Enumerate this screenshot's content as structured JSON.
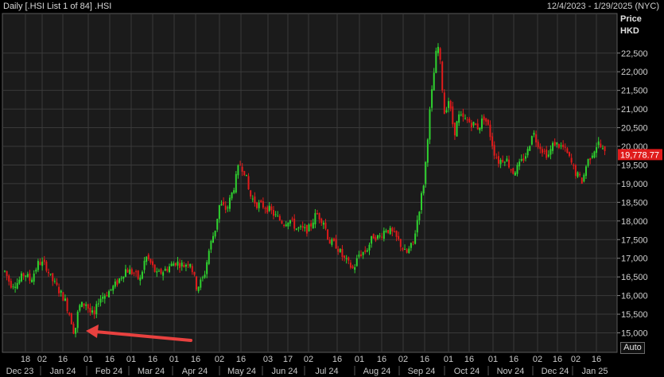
{
  "title": {
    "left": "Daily [.HSI List 1 of 84] .HSI",
    "right": "12/4/2023 - 1/29/2025 (NYC)"
  },
  "axis": {
    "price_label": "Price",
    "currency_label": "HKD",
    "last_price_label": "19,778.77",
    "auto_button": "Auto"
  },
  "colors": {
    "background": "#000000",
    "plot_background": "#1b1b1b",
    "grid": "#3a3a3a",
    "up": "#2fd22f",
    "down": "#e01b1b",
    "arrow": "#e8413f",
    "last_price_bg": "#e01b1b"
  },
  "icons": {
    "annotation": "red-arrow-icon"
  },
  "chart_data": {
    "type": "candlestick",
    "interval": "Daily",
    "symbol": ".HSI",
    "date_range": "12/4/2023 - 1/29/2025 (NYC)",
    "ylabel": "Price HKD",
    "ylim": [
      14600,
      23100
    ],
    "yticks": [
      15000,
      15500,
      16000,
      16500,
      17000,
      17500,
      18000,
      18500,
      19000,
      19500,
      20000,
      20500,
      21000,
      21500,
      22000,
      22500
    ],
    "ytick_labels": [
      "15,000",
      "15,500",
      "16,000",
      "16,500",
      "17,000",
      "17,500",
      "18,000",
      "18,500",
      "19,000",
      "19,500",
      "20,000",
      "20,500",
      "21,000",
      "21,500",
      "22,000",
      "22,500"
    ],
    "last_price": 19778.77,
    "x_day_ticks": [
      "18",
      "02",
      "16",
      "01",
      "16",
      "01",
      "16",
      "01",
      "16",
      "02",
      "16",
      "03",
      "17",
      "02",
      "16",
      "01",
      "16",
      "02",
      "16",
      "01",
      "16",
      "01",
      "16",
      "02",
      "16",
      "02",
      "16"
    ],
    "x_month_ticks": [
      "Dec 23",
      "Jan 24",
      "Feb 24",
      "Mar 24",
      "Apr 24",
      "May 24",
      "Jun 24",
      "Jul 24",
      "Aug 24",
      "Sep 24",
      "Oct 24",
      "Nov 24",
      "Dec 24",
      "Jan 25"
    ],
    "close_path": [
      [
        "2023-12-04",
        16650
      ],
      [
        "2023-12-08",
        16300
      ],
      [
        "2023-12-13",
        16350
      ],
      [
        "2023-12-18",
        16600
      ],
      [
        "2023-12-22",
        16400
      ],
      [
        "2023-12-28",
        16900
      ],
      [
        "2024-01-02",
        16800
      ],
      [
        "2024-01-05",
        16500
      ],
      [
        "2024-01-10",
        16200
      ],
      [
        "2024-01-15",
        15900
      ],
      [
        "2024-01-19",
        15450
      ],
      [
        "2024-01-22",
        14960
      ],
      [
        "2024-01-25",
        15700
      ],
      [
        "2024-01-30",
        15800
      ],
      [
        "2024-02-02",
        15550
      ],
      [
        "2024-02-05",
        15450
      ],
      [
        "2024-02-08",
        15900
      ],
      [
        "2024-02-15",
        16100
      ],
      [
        "2024-02-20",
        16300
      ],
      [
        "2024-02-27",
        16700
      ],
      [
        "2024-03-04",
        16600
      ],
      [
        "2024-03-08",
        16400
      ],
      [
        "2024-03-12",
        17050
      ],
      [
        "2024-03-15",
        16900
      ],
      [
        "2024-03-20",
        16550
      ],
      [
        "2024-03-26",
        16700
      ],
      [
        "2024-04-02",
        16900
      ],
      [
        "2024-04-08",
        16800
      ],
      [
        "2024-04-12",
        16950
      ],
      [
        "2024-04-17",
        16200
      ],
      [
        "2024-04-22",
        16500
      ],
      [
        "2024-04-26",
        17300
      ],
      [
        "2024-04-30",
        17800
      ],
      [
        "2024-05-03",
        18450
      ],
      [
        "2024-05-08",
        18300
      ],
      [
        "2024-05-13",
        18900
      ],
      [
        "2024-05-17",
        19550
      ],
      [
        "2024-05-21",
        19300
      ],
      [
        "2024-05-24",
        18700
      ],
      [
        "2024-05-29",
        18450
      ],
      [
        "2024-06-03",
        18400
      ],
      [
        "2024-06-07",
        18300
      ],
      [
        "2024-06-12",
        18100
      ],
      [
        "2024-06-17",
        17950
      ],
      [
        "2024-06-21",
        18050
      ],
      [
        "2024-06-26",
        17800
      ],
      [
        "2024-07-02",
        17750
      ],
      [
        "2024-07-05",
        17800
      ],
      [
        "2024-07-10",
        18200
      ],
      [
        "2024-07-15",
        18000
      ],
      [
        "2024-07-19",
        17450
      ],
      [
        "2024-07-24",
        17350
      ],
      [
        "2024-07-29",
        17000
      ],
      [
        "2024-08-05",
        16700
      ],
      [
        "2024-08-09",
        17100
      ],
      [
        "2024-08-14",
        17200
      ],
      [
        "2024-08-19",
        17600
      ],
      [
        "2024-08-23",
        17550
      ],
      [
        "2024-08-28",
        17800
      ],
      [
        "2024-09-02",
        17650
      ],
      [
        "2024-09-06",
        17450
      ],
      [
        "2024-09-11",
        17100
      ],
      [
        "2024-09-16",
        17400
      ],
      [
        "2024-09-20",
        18250
      ],
      [
        "2024-09-24",
        19150
      ],
      [
        "2024-09-27",
        20650
      ],
      [
        "2024-10-02",
        22450
      ],
      [
        "2024-10-04",
        22700
      ],
      [
        "2024-10-08",
        20900
      ],
      [
        "2024-10-11",
        21250
      ],
      [
        "2024-10-15",
        20350
      ],
      [
        "2024-10-18",
        20800
      ],
      [
        "2024-10-23",
        20700
      ],
      [
        "2024-10-28",
        20600
      ],
      [
        "2024-11-01",
        20500
      ],
      [
        "2024-11-05",
        20800
      ],
      [
        "2024-11-08",
        20500
      ],
      [
        "2024-11-12",
        19850
      ],
      [
        "2024-11-15",
        19600
      ],
      [
        "2024-11-20",
        19700
      ],
      [
        "2024-11-25",
        19300
      ],
      [
        "2024-11-29",
        19450
      ],
      [
        "2024-12-03",
        19700
      ],
      [
        "2024-12-06",
        19900
      ],
      [
        "2024-12-09",
        20450
      ],
      [
        "2024-12-11",
        20200
      ],
      [
        "2024-12-16",
        19900
      ],
      [
        "2024-12-20",
        19750
      ],
      [
        "2024-12-24",
        20100
      ],
      [
        "2024-12-31",
        19950
      ],
      [
        "2025-01-03",
        19750
      ],
      [
        "2025-01-08",
        19300
      ],
      [
        "2025-01-13",
        19050
      ],
      [
        "2025-01-16",
        19550
      ],
      [
        "2025-01-21",
        19900
      ],
      [
        "2025-01-24",
        20100
      ],
      [
        "2025-01-29",
        19779
      ]
    ],
    "annotation": {
      "type": "arrow",
      "points_to_date": "2024-01-22",
      "points_to_price": 14961
    }
  }
}
